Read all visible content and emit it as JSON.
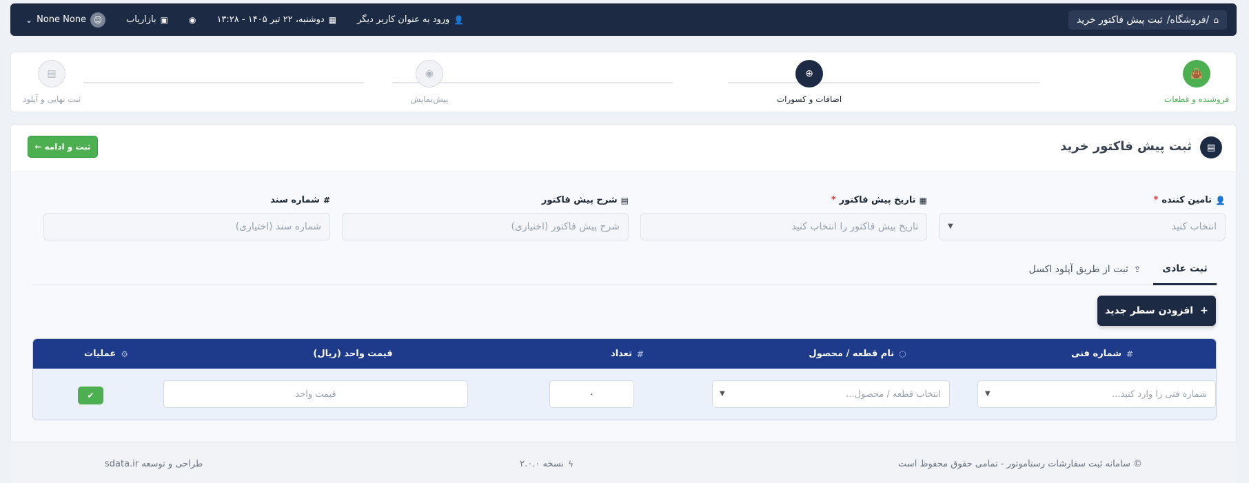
{
  "header": {
    "breadcrumb_root": "/فروشگاه/",
    "breadcrumb_page": "ثبت پیش فاکتور خرید",
    "login_as_label": "ورود به عنوان کاربر دیگر",
    "datetime": "دوشنبه، ۲۲ تیر ۱۴۰۵ - ۱۳:۲۸",
    "role": "بازاریاب",
    "user_name": "None None"
  },
  "steps": [
    {
      "label": "فروشنده و قطعات",
      "state": "done"
    },
    {
      "label": "اضافات و کسورات",
      "state": "active"
    },
    {
      "label": "پیش‌نمایش",
      "state": "pending"
    },
    {
      "label": "ثبت نهایی و آپلود",
      "state": "pending"
    }
  ],
  "page": {
    "title": "ثبت پیش فاکتور خرید",
    "save_button": "ثبت و ادامه"
  },
  "form": {
    "supplier": {
      "label": "تامین کننده",
      "placeholder": "انتخاب کنید"
    },
    "invoice_date": {
      "label": "تاریخ پیش فاکتور",
      "placeholder": "تاریخ پیش فاکتور را انتخاب کنید"
    },
    "description": {
      "label": "شرح پیش فاکتور",
      "placeholder": "شرح پیش فاکتور (اختیاری)"
    },
    "doc_number": {
      "label": "شماره سند",
      "placeholder": "شماره سند (اختیاری)"
    }
  },
  "tabs": {
    "normal": "ثبت عادی",
    "excel": "ثبت از طریق آپلود اکسل"
  },
  "add_row_button": "افزودن سطر جدید",
  "table": {
    "columns": {
      "part_number": "شماره فنی",
      "product": "نام قطعه / محصول",
      "quantity": "تعداد",
      "unit_price": "قیمت واحد (ریال)",
      "actions": "عملیات"
    },
    "row": {
      "part_number_placeholder": "شماره فنی را وارد کنید...",
      "product_placeholder": "انتخاب قطعه / محصول...",
      "quantity_value": "۰",
      "unit_price_placeholder": "قیمت واحد"
    }
  },
  "footer": {
    "copyright": "© سامانه ثبت سفارشات رستاموتور - تمامی حقوق محفوظ است",
    "version": "نسخه ۲.۰.۰",
    "credit": "طراحی و توسعه sdata.ir"
  },
  "colors": {
    "navy": "#1d2a44",
    "table_header": "#1e3a8a",
    "green": "#4caf50",
    "required": "#e53935"
  }
}
